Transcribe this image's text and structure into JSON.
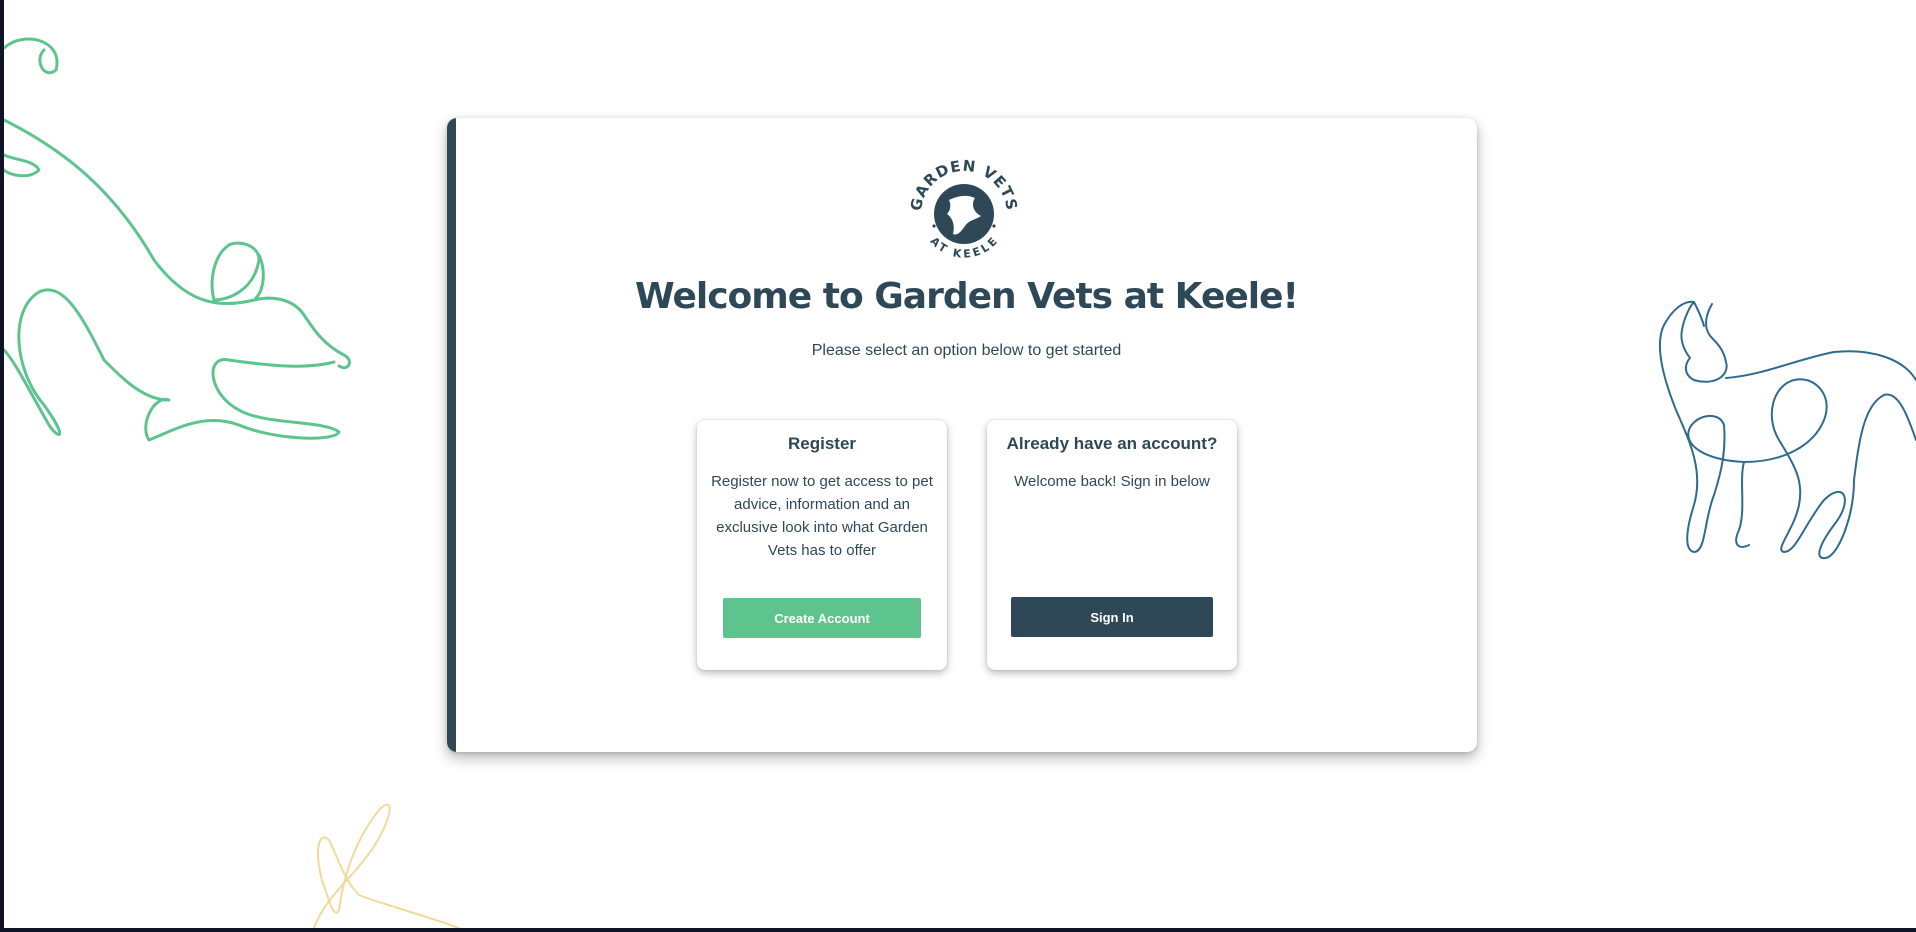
{
  "header": {
    "logo": {
      "top_text": "GARDEN VETS",
      "bottom_text": "AT KEELE",
      "icon": "dog-and-cat-icon"
    },
    "title": "Welcome to Garden Vets at Keele!",
    "subtitle": "Please select an option below to get started"
  },
  "options": {
    "register": {
      "title": "Register",
      "description": "Register now to get access to pet advice, information and an exclusive look into what Garden Vets has to offer",
      "button_label": "Create Account"
    },
    "signin": {
      "title": "Already have an account?",
      "description": "Welcome back! Sign in below",
      "button_label": "Sign In"
    }
  },
  "decorations": {
    "left_animal": "dog-line-art",
    "right_animal": "cat-line-art",
    "bottom_animal": "rabbit-line-art"
  },
  "colors": {
    "primary": "#2f4858",
    "accent_green": "#5ec48e",
    "decor_yellow": "#f3d99a",
    "background": "#ffffff"
  }
}
